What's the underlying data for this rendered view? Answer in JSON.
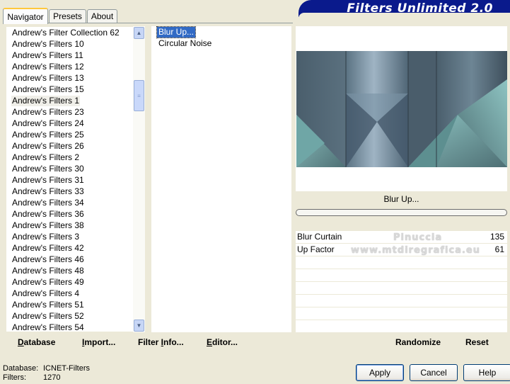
{
  "tabs": [
    "Navigator",
    "Presets",
    "About"
  ],
  "banner": "Filters Unlimited 2.0",
  "categories": [
    "Andrew's Filter Collection 62",
    "Andrew's Filters 10",
    "Andrew's Filters 11",
    "Andrew's Filters 12",
    "Andrew's Filters 13",
    "Andrew's Filters 15",
    "Andrew's Filters 1",
    "Andrew's Filters 23",
    "Andrew's Filters 24",
    "Andrew's Filters 25",
    "Andrew's Filters 26",
    "Andrew's Filters 2",
    "Andrew's Filters 30",
    "Andrew's Filters 31",
    "Andrew's Filters 33",
    "Andrew's Filters 34",
    "Andrew's Filters 36",
    "Andrew's Filters 38",
    "Andrew's Filters 3",
    "Andrew's Filters 42",
    "Andrew's Filters 46",
    "Andrew's Filters 48",
    "Andrew's Filters 49",
    "Andrew's Filters 4",
    "Andrew's Filters 51",
    "Andrew's Filters 52",
    "Andrew's Filters 54"
  ],
  "selected_category": "Andrew's Filters 1",
  "filters": [
    "Blur Up...",
    "Circular Noise"
  ],
  "selected_filter": "Blur Up...",
  "filter_name": "Blur Up...",
  "parameters": [
    {
      "label": "Blur Curtain",
      "value": "135"
    },
    {
      "label": "Up Factor",
      "value": "61"
    }
  ],
  "watermark": {
    "line1": "Pinuccia",
    "line2": "www.mtdiregrafica.eu"
  },
  "link_buttons": {
    "database": {
      "u": "D",
      "rest": "atabase"
    },
    "import": {
      "u": "I",
      "rest": "mport..."
    },
    "filter_info": {
      "pre": "Filter ",
      "u": "I",
      "rest": "nfo..."
    },
    "editor": {
      "u": "E",
      "rest": "ditor..."
    }
  },
  "randomize": "Randomize",
  "reset": "Reset",
  "status": {
    "database_label": "Database:",
    "database_value": "ICNET-Filters",
    "filters_label": "Filters:",
    "filters_value": "1270"
  },
  "buttons": {
    "apply": "Apply",
    "cancel": "Cancel",
    "help": "Help"
  }
}
